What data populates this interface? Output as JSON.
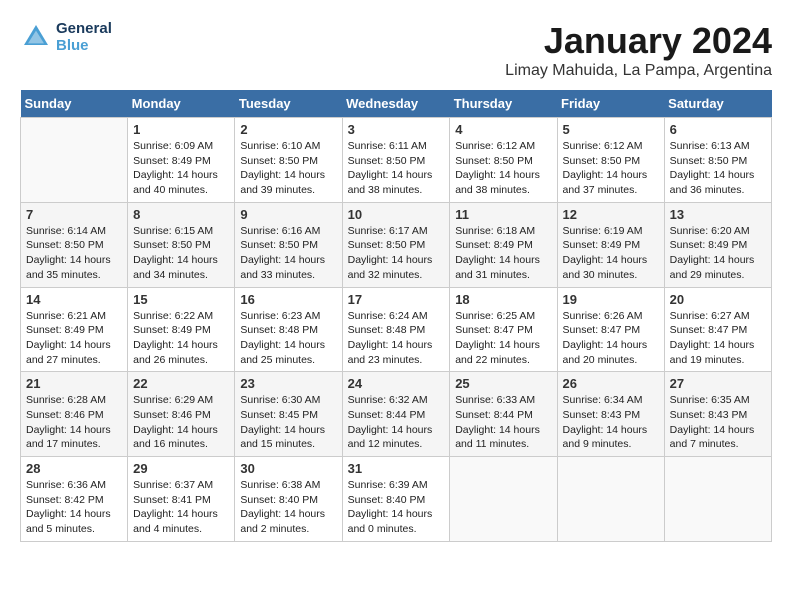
{
  "header": {
    "logo_line1": "General",
    "logo_line2": "Blue",
    "title": "January 2024",
    "subtitle": "Limay Mahuida, La Pampa, Argentina"
  },
  "days_of_week": [
    "Sunday",
    "Monday",
    "Tuesday",
    "Wednesday",
    "Thursday",
    "Friday",
    "Saturday"
  ],
  "weeks": [
    [
      {
        "day": "",
        "info": ""
      },
      {
        "day": "1",
        "info": "Sunrise: 6:09 AM\nSunset: 8:49 PM\nDaylight: 14 hours\nand 40 minutes."
      },
      {
        "day": "2",
        "info": "Sunrise: 6:10 AM\nSunset: 8:50 PM\nDaylight: 14 hours\nand 39 minutes."
      },
      {
        "day": "3",
        "info": "Sunrise: 6:11 AM\nSunset: 8:50 PM\nDaylight: 14 hours\nand 38 minutes."
      },
      {
        "day": "4",
        "info": "Sunrise: 6:12 AM\nSunset: 8:50 PM\nDaylight: 14 hours\nand 38 minutes."
      },
      {
        "day": "5",
        "info": "Sunrise: 6:12 AM\nSunset: 8:50 PM\nDaylight: 14 hours\nand 37 minutes."
      },
      {
        "day": "6",
        "info": "Sunrise: 6:13 AM\nSunset: 8:50 PM\nDaylight: 14 hours\nand 36 minutes."
      }
    ],
    [
      {
        "day": "7",
        "info": "Sunrise: 6:14 AM\nSunset: 8:50 PM\nDaylight: 14 hours\nand 35 minutes."
      },
      {
        "day": "8",
        "info": "Sunrise: 6:15 AM\nSunset: 8:50 PM\nDaylight: 14 hours\nand 34 minutes."
      },
      {
        "day": "9",
        "info": "Sunrise: 6:16 AM\nSunset: 8:50 PM\nDaylight: 14 hours\nand 33 minutes."
      },
      {
        "day": "10",
        "info": "Sunrise: 6:17 AM\nSunset: 8:50 PM\nDaylight: 14 hours\nand 32 minutes."
      },
      {
        "day": "11",
        "info": "Sunrise: 6:18 AM\nSunset: 8:49 PM\nDaylight: 14 hours\nand 31 minutes."
      },
      {
        "day": "12",
        "info": "Sunrise: 6:19 AM\nSunset: 8:49 PM\nDaylight: 14 hours\nand 30 minutes."
      },
      {
        "day": "13",
        "info": "Sunrise: 6:20 AM\nSunset: 8:49 PM\nDaylight: 14 hours\nand 29 minutes."
      }
    ],
    [
      {
        "day": "14",
        "info": "Sunrise: 6:21 AM\nSunset: 8:49 PM\nDaylight: 14 hours\nand 27 minutes."
      },
      {
        "day": "15",
        "info": "Sunrise: 6:22 AM\nSunset: 8:49 PM\nDaylight: 14 hours\nand 26 minutes."
      },
      {
        "day": "16",
        "info": "Sunrise: 6:23 AM\nSunset: 8:48 PM\nDaylight: 14 hours\nand 25 minutes."
      },
      {
        "day": "17",
        "info": "Sunrise: 6:24 AM\nSunset: 8:48 PM\nDaylight: 14 hours\nand 23 minutes."
      },
      {
        "day": "18",
        "info": "Sunrise: 6:25 AM\nSunset: 8:47 PM\nDaylight: 14 hours\nand 22 minutes."
      },
      {
        "day": "19",
        "info": "Sunrise: 6:26 AM\nSunset: 8:47 PM\nDaylight: 14 hours\nand 20 minutes."
      },
      {
        "day": "20",
        "info": "Sunrise: 6:27 AM\nSunset: 8:47 PM\nDaylight: 14 hours\nand 19 minutes."
      }
    ],
    [
      {
        "day": "21",
        "info": "Sunrise: 6:28 AM\nSunset: 8:46 PM\nDaylight: 14 hours\nand 17 minutes."
      },
      {
        "day": "22",
        "info": "Sunrise: 6:29 AM\nSunset: 8:46 PM\nDaylight: 14 hours\nand 16 minutes."
      },
      {
        "day": "23",
        "info": "Sunrise: 6:30 AM\nSunset: 8:45 PM\nDaylight: 14 hours\nand 15 minutes."
      },
      {
        "day": "24",
        "info": "Sunrise: 6:32 AM\nSunset: 8:44 PM\nDaylight: 14 hours\nand 12 minutes."
      },
      {
        "day": "25",
        "info": "Sunrise: 6:33 AM\nSunset: 8:44 PM\nDaylight: 14 hours\nand 11 minutes."
      },
      {
        "day": "26",
        "info": "Sunrise: 6:34 AM\nSunset: 8:43 PM\nDaylight: 14 hours\nand 9 minutes."
      },
      {
        "day": "27",
        "info": "Sunrise: 6:35 AM\nSunset: 8:43 PM\nDaylight: 14 hours\nand 7 minutes."
      }
    ],
    [
      {
        "day": "28",
        "info": "Sunrise: 6:36 AM\nSunset: 8:42 PM\nDaylight: 14 hours\nand 5 minutes."
      },
      {
        "day": "29",
        "info": "Sunrise: 6:37 AM\nSunset: 8:41 PM\nDaylight: 14 hours\nand 4 minutes."
      },
      {
        "day": "30",
        "info": "Sunrise: 6:38 AM\nSunset: 8:40 PM\nDaylight: 14 hours\nand 2 minutes."
      },
      {
        "day": "31",
        "info": "Sunrise: 6:39 AM\nSunset: 8:40 PM\nDaylight: 14 hours\nand 0 minutes."
      },
      {
        "day": "",
        "info": ""
      },
      {
        "day": "",
        "info": ""
      },
      {
        "day": "",
        "info": ""
      }
    ]
  ]
}
